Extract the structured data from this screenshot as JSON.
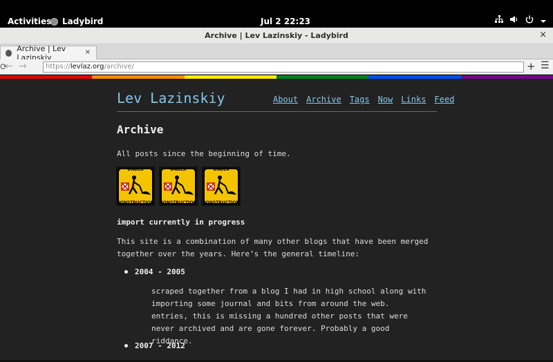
{
  "topbar": {
    "activities": "Activities",
    "app_name": "Ladybird",
    "clock": "Jul 2  22:23"
  },
  "window": {
    "title": "Archive | Lev Lazinskiy - Ladybird",
    "close_glyph": "×"
  },
  "tab": {
    "title": "Archive | Lev Lazinskiy",
    "close_glyph": "×"
  },
  "toolbar": {
    "back_glyph": "←",
    "forward_glyph": "→",
    "reload_glyph": "⟳",
    "url_scheme": "https://",
    "url_host": "levlaz.org",
    "url_path": "/archive/",
    "new_tab_glyph": "+",
    "menu_glyph": "☰"
  },
  "rainbow_colors": [
    "#e40303",
    "#ff8c00",
    "#ffed00",
    "#008026",
    "#004dff",
    "#750787"
  ],
  "site": {
    "title": "Lev Lazinskiy",
    "nav": [
      "About",
      "Archive",
      "Tags",
      "Now",
      "Links",
      "Feed"
    ]
  },
  "content": {
    "heading": "Archive",
    "intro": "All posts since the beginning of time.",
    "badge_top": "UNDER",
    "badge_bottom": "CONSTRUCTION",
    "notice": "import currently in progress",
    "paragraph": "This site is a combination of many other blogs that have been merged together over the years. Here’s the general timeline:",
    "timeline": [
      {
        "period": "2004 - 2005",
        "description": "scraped together from a blog I had in high school along with importing some journal and bits from around the web. entries, this is missing a hundred other posts that were never archived and are gone forever. Probably a good riddance."
      },
      {
        "period": "2007 - 2012"
      }
    ]
  },
  "colors": {
    "page_bg": "#222222",
    "link": "#84c6e8",
    "sign_yellow": "#f5c400"
  }
}
